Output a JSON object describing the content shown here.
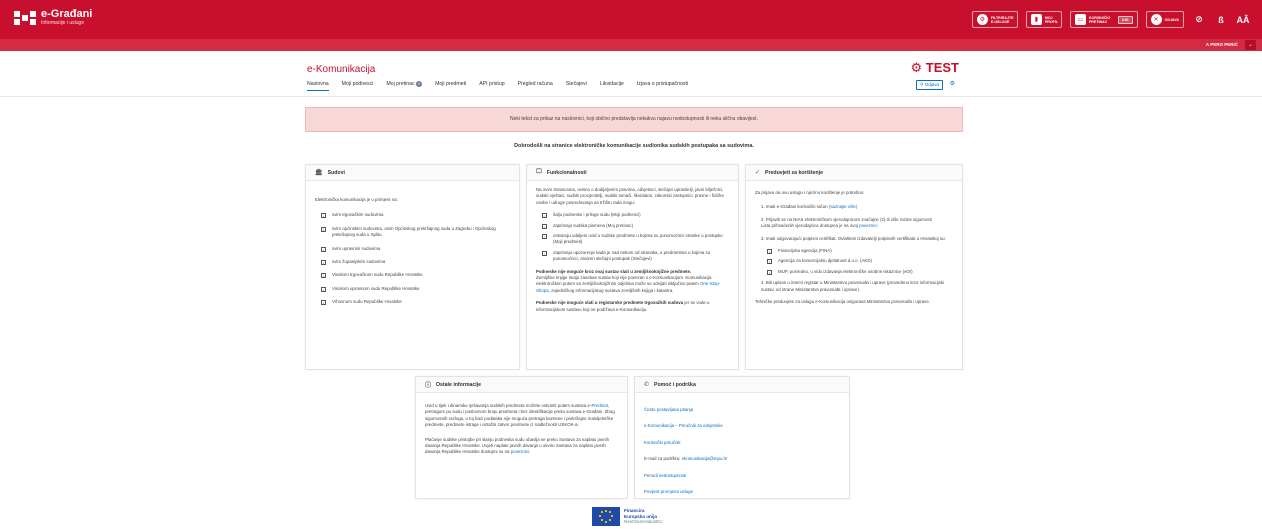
{
  "brand": {
    "title": "e-Građani",
    "subtitle": "Informacije i usluge"
  },
  "topbar": {
    "tools": [
      {
        "label": "FILTRIRAJTE E-USLUGE",
        "icon": "filter-icon"
      },
      {
        "label": "MOJ PROFIL",
        "icon": "profile-icon"
      },
      {
        "label": "KORISNIČKI PRETINAC",
        "icon": "inbox-icon",
        "count": "210"
      },
      {
        "label": "ODJAVA",
        "icon": "logout-icon"
      }
    ],
    "contrast_glyph": "⊘",
    "language_glyph": "ß",
    "font_size_glyph": "AÂ",
    "user_name": "PERO PERIĆ",
    "user_glyph": "A"
  },
  "header": {
    "app_title": "e-Komunikacija",
    "test_label": "TEST",
    "logout_label": "Odjava",
    "tabs": [
      {
        "label": "Naslovna",
        "active": true
      },
      {
        "label": "Moji podnesci"
      },
      {
        "label": "Moj pretinac",
        "count": "0"
      },
      {
        "label": "Moji predmeti"
      },
      {
        "label": "API pristup"
      },
      {
        "label": "Pregled računa"
      },
      {
        "label": "Stečajevi"
      },
      {
        "label": "Likvidacije"
      },
      {
        "label": "Izjava o pristupačnosti"
      }
    ]
  },
  "alert_text": "Neki tekst za prikaz na naslovnici, koji obično predstavlja nekakvu najavu nedostupnosti ili neku sličnu obavijest.",
  "welcome_text": "Dobrodošli na stranice elektroničke komunikacije sudionika sudskih postupaka sa sudovima.",
  "sudovi": {
    "title": "Sudovi",
    "intro": "Elektronička komunikacija je u primjeni na:",
    "items": [
      "svim trgovačkim sudovima",
      "svim općinskim sudovima, osim Općinskog prekršajnog suda u Zagrebu i Općinskog prekršajnog suda u Splitu",
      "svim upravnim sudovima",
      "svim županijskim sudovima",
      "Visokom trgovačkom sudu Republike Hrvatske",
      "Visokom upravnom sudu Republike Hrvatske",
      "Vrhovnom sudu Republike Hrvatske"
    ]
  },
  "funkcionalnosti": {
    "title": "Funkcionalnosti",
    "intro": "Na ovim stranicama, ovisno o dodijeljenim pravima, odvjetnici, stečajni upravitelji, javni bilježnici, sudski vještaci, sudski procjenitelji, sudski tumači, likvidatori, zakonski zastupnici, pravne i fizičke osobe i udruge posredovanja na tržištu rada mogu:",
    "items": [
      "šalju podneske i priloge sudu (Moji podnesci)",
      "zaprimaju sudska pismena (Moj pretinac)",
      "ostvaruju udaljeni uvid u sudske predmete u kojima su punomoćnici stranke u postupku (Moji predmeti)",
      "zaprimaju upozorenje kada je nad nekom od stranaka, u predmetima u kojima su punomoćnici, otvoren stečajni postupak (Stečajevi)"
    ],
    "note1_bold": "Podneske nije moguće kroz ovaj sustav slati u zemljišnoknjižne predmete.",
    "note1_pre": "Zemljišne knjige imaju zaseban sustav koji nije povezan s e-Komunikacijom. Komunikacija elektroničkim putem sa zemljišnoknjižnim odjelima može se odvijati isključivo putem",
    "note1_link": "One-Stop-Shopa",
    "note1_post": ", zajedničkog informacijskog sustava zemljišnih knjiga i katastra.",
    "note2_bold": "Podneske nije moguće slati u registarske predmete trgovačkih sudova",
    "note2_post": " jer se vode u informacijskom sustavu koji ne podržava e-Komunikaciju."
  },
  "preduvjeti": {
    "title": "Preduvjeti za korištenje",
    "intro": "Za prijavu na ovu uslugu i njezino korištenje je potrebno:",
    "step1_text": "1. Imati e-Građani korisnički račun",
    "step1_link": "(saznajte više)",
    "step2_text": "2. Prijaviti se na NIAS elektroničkom vjerodajnicom značajne (2) ili više razine sigurnosti",
    "step2_sub": "Lista prihvaćenih vjerodajnica dostupna je na ovoj",
    "step2_link": "poveznici",
    "step3_text": "3. Imati odgovarajući potpisni certifikat. Ovlašteni izdavatelji potpisnih certifikata u Hrvatskoj su:",
    "issuers": [
      "Financijska agencija (FINA)",
      "Agencija za komercijalnu djelatnost d.o.o. (AKD)",
      "MUP, posredno, u vidu izdavanja elektroničke osobne iskaznice (eOI)"
    ],
    "step4_text": "4. Biti upisan u interni registar u Ministarstvu pravosuđa i uprave (provedeno kroz informacijski sustav, od strane Ministarstva pravosuđa i uprave).",
    "footer_text": "Tehničke preduvjete za uslugu e-Komunikacija osigurava Ministarstvo pravosuđa i uprave."
  },
  "ostale": {
    "title": "Ostale informacije",
    "p1_pre": "Uvid u tijek i dinamiku rješavanja sudskih predmeta možete ostvariti putem sustava e-",
    "p1_link": "Predmet",
    "p1_post": ", pretragom po sudu i poslovnom broju predmeta i bez identifikacije preko sustava e-Građani. Zbog sigurnosnih razloga, u toj bazi podataka nije moguća pretraga kaznene i prekršajne maloljetničke predmete, predmete istrage i istražni zatvor predmete iz nadležnosti USKOK-a.",
    "p2_pre": "Plaćanje sudske pristojbe pri slanju podneska sudu obavlja se preko Sustava za naplatu javnih davanja Republike Hrvatske. Uvjeti naplate javnih davanja u okviru Sustava za naplatu javnih davanja Republike Hrvatske dostupni su na",
    "p2_link": "poveznici",
    "p2_post": "."
  },
  "pomoc": {
    "title": "Pomoć i podrška",
    "links": [
      "Često postavljana pitanja",
      "e-Komunikacija – Priručnik za odvjetnike",
      "Korisnički priručnik"
    ],
    "email_label": "E-mail za podršku:",
    "email": "ekomunikacija@mpu.hr",
    "links2": [
      "Periodi nedostupnosti",
      "Povijest promjena usluge"
    ]
  },
  "footer": {
    "line1": "Financira",
    "line2": "Europska unija",
    "line3": "NextGenerationEU"
  },
  "colors": {
    "brand_red": "#c8102e",
    "link_blue": "#0a6ebd",
    "alert_bg": "#f8d7d7",
    "eu_blue": "#1f4aa8"
  }
}
